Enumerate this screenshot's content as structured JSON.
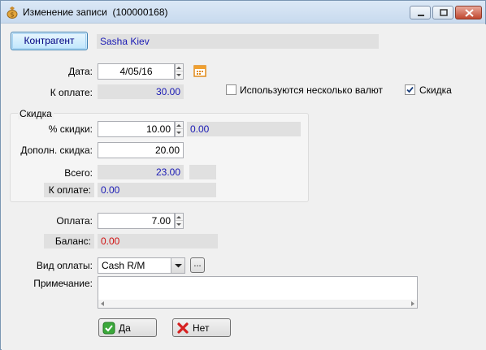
{
  "window": {
    "title": "Изменение записи",
    "record_id": "(100000168)",
    "icons": {
      "app": "money-bag-icon",
      "minimize": "minimize-icon",
      "maximize": "maximize-icon",
      "close": "close-icon"
    }
  },
  "header": {
    "contragent_button": "Контрагент",
    "contragent_name": "Sasha Kiev"
  },
  "date_section": {
    "date_label": "Дата:",
    "date_value": "4/05/16",
    "calendar_icon": "calendar-icon",
    "due_label": "К оплате:",
    "due_value": "30.00",
    "multi_currency_label": "Используются несколько валют",
    "multi_currency_checked": false,
    "discount_checkbox_label": "Скидка",
    "discount_checked": true
  },
  "discount_group": {
    "title": "Скидка",
    "percent_label": "% скидки:",
    "percent_value": "10.00",
    "percent_amount": "0.00",
    "extra_label": "Дополн. скидка:",
    "extra_value": "20.00",
    "total_label": "Всего:",
    "total_value": "23.00",
    "due_label": "К оплате:",
    "due_value": "0.00"
  },
  "payment": {
    "payment_label": "Оплата:",
    "payment_value": "7.00",
    "balance_label": "Баланс:",
    "balance_value": "0.00",
    "method_label": "Вид оплаты:",
    "method_value": "Cash R/M",
    "browse_label": "...",
    "note_label": "Примечание:",
    "note_value": ""
  },
  "actions": {
    "ok_label": "Да",
    "cancel_label": "Нет"
  },
  "colors": {
    "value_blue": "#1a1ab4",
    "balance_red": "#d01010",
    "readonly_bg": "#e0e0e0"
  }
}
